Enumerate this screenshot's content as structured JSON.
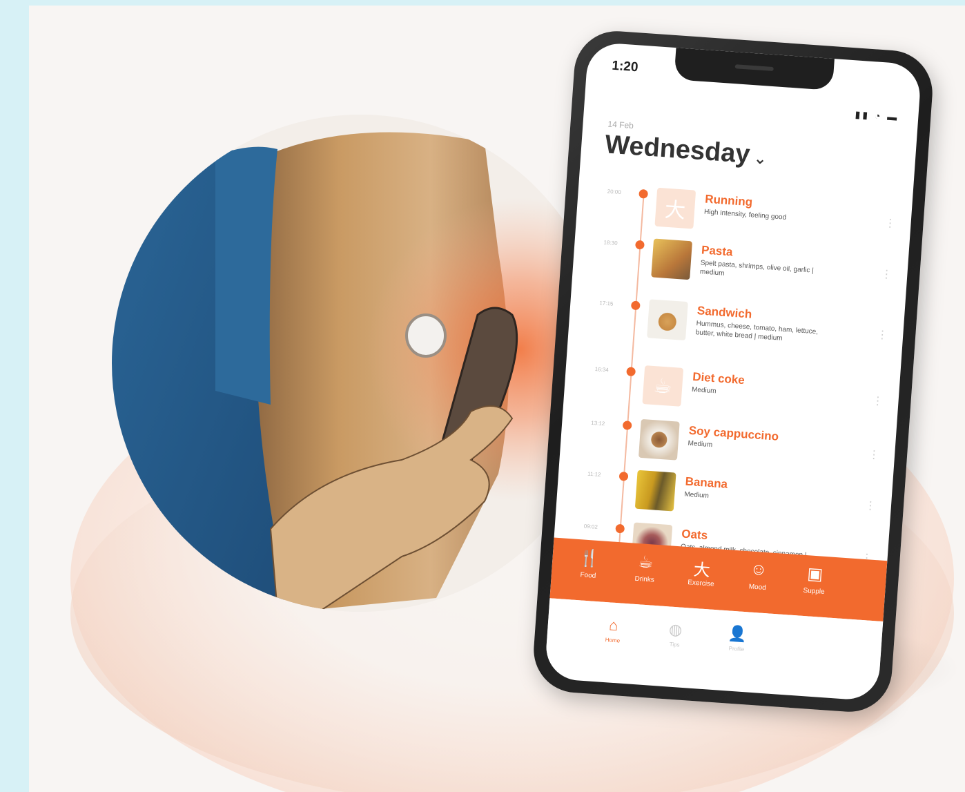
{
  "phone": {
    "status_time": "1:20",
    "status_icons": "▮▮ ◔ ▬",
    "date_small": "14 Feb",
    "day_title": "Wednesday",
    "chevron": "⌄"
  },
  "timeline": [
    {
      "time": "20:00",
      "title": "Running",
      "desc": "High intensity, feeling good",
      "icon": "running-icon",
      "glyph": "大"
    },
    {
      "time": "18:30",
      "title": "Pasta",
      "desc": "Spelt pasta, shrimps, olive oil, garlic | medium",
      "icon": "pasta-photo",
      "glyph": ""
    },
    {
      "time": "17:15",
      "title": "Sandwich",
      "desc": "Hummus, cheese, tomato, ham, lettuce, butter, white bread | medium",
      "icon": "sandwich-photo",
      "glyph": ""
    },
    {
      "time": "16:34",
      "title": "Diet coke",
      "desc": "Medium",
      "icon": "drink-icon",
      "glyph": "☕"
    },
    {
      "time": "13:12",
      "title": "Soy cappuccino",
      "desc": "Medium",
      "icon": "coffee-photo",
      "glyph": ""
    },
    {
      "time": "11:12",
      "title": "Banana",
      "desc": "Medium",
      "icon": "banana-photo",
      "glyph": ""
    },
    {
      "time": "09:02",
      "title": "Oats",
      "desc": "Oats, almond milk, chocolate, cinnamon | medium",
      "icon": "oats-photo",
      "glyph": ""
    }
  ],
  "actions": [
    {
      "label": "Food",
      "icon": "fork-knife-icon",
      "glyph": "🍴"
    },
    {
      "label": "Drinks",
      "icon": "cup-icon",
      "glyph": "☕"
    },
    {
      "label": "Exercise",
      "icon": "exercise-icon",
      "glyph": "大"
    },
    {
      "label": "Mood",
      "icon": "smiley-icon",
      "glyph": "☺"
    },
    {
      "label": "Supple",
      "icon": "pill-icon",
      "glyph": "▣"
    }
  ],
  "tabs": [
    {
      "label": "Home",
      "icon": "home-icon",
      "glyph": "⌂",
      "active": true
    },
    {
      "label": "Tips",
      "icon": "bulb-icon",
      "glyph": "◍",
      "active": false
    },
    {
      "label": "Profile",
      "icon": "person-icon",
      "glyph": "👤",
      "active": false
    }
  ],
  "colors": {
    "accent": "#f26a2e",
    "background": "#d7f1f6",
    "shirt": "#2f6e9e",
    "skin": "#c99a63"
  }
}
